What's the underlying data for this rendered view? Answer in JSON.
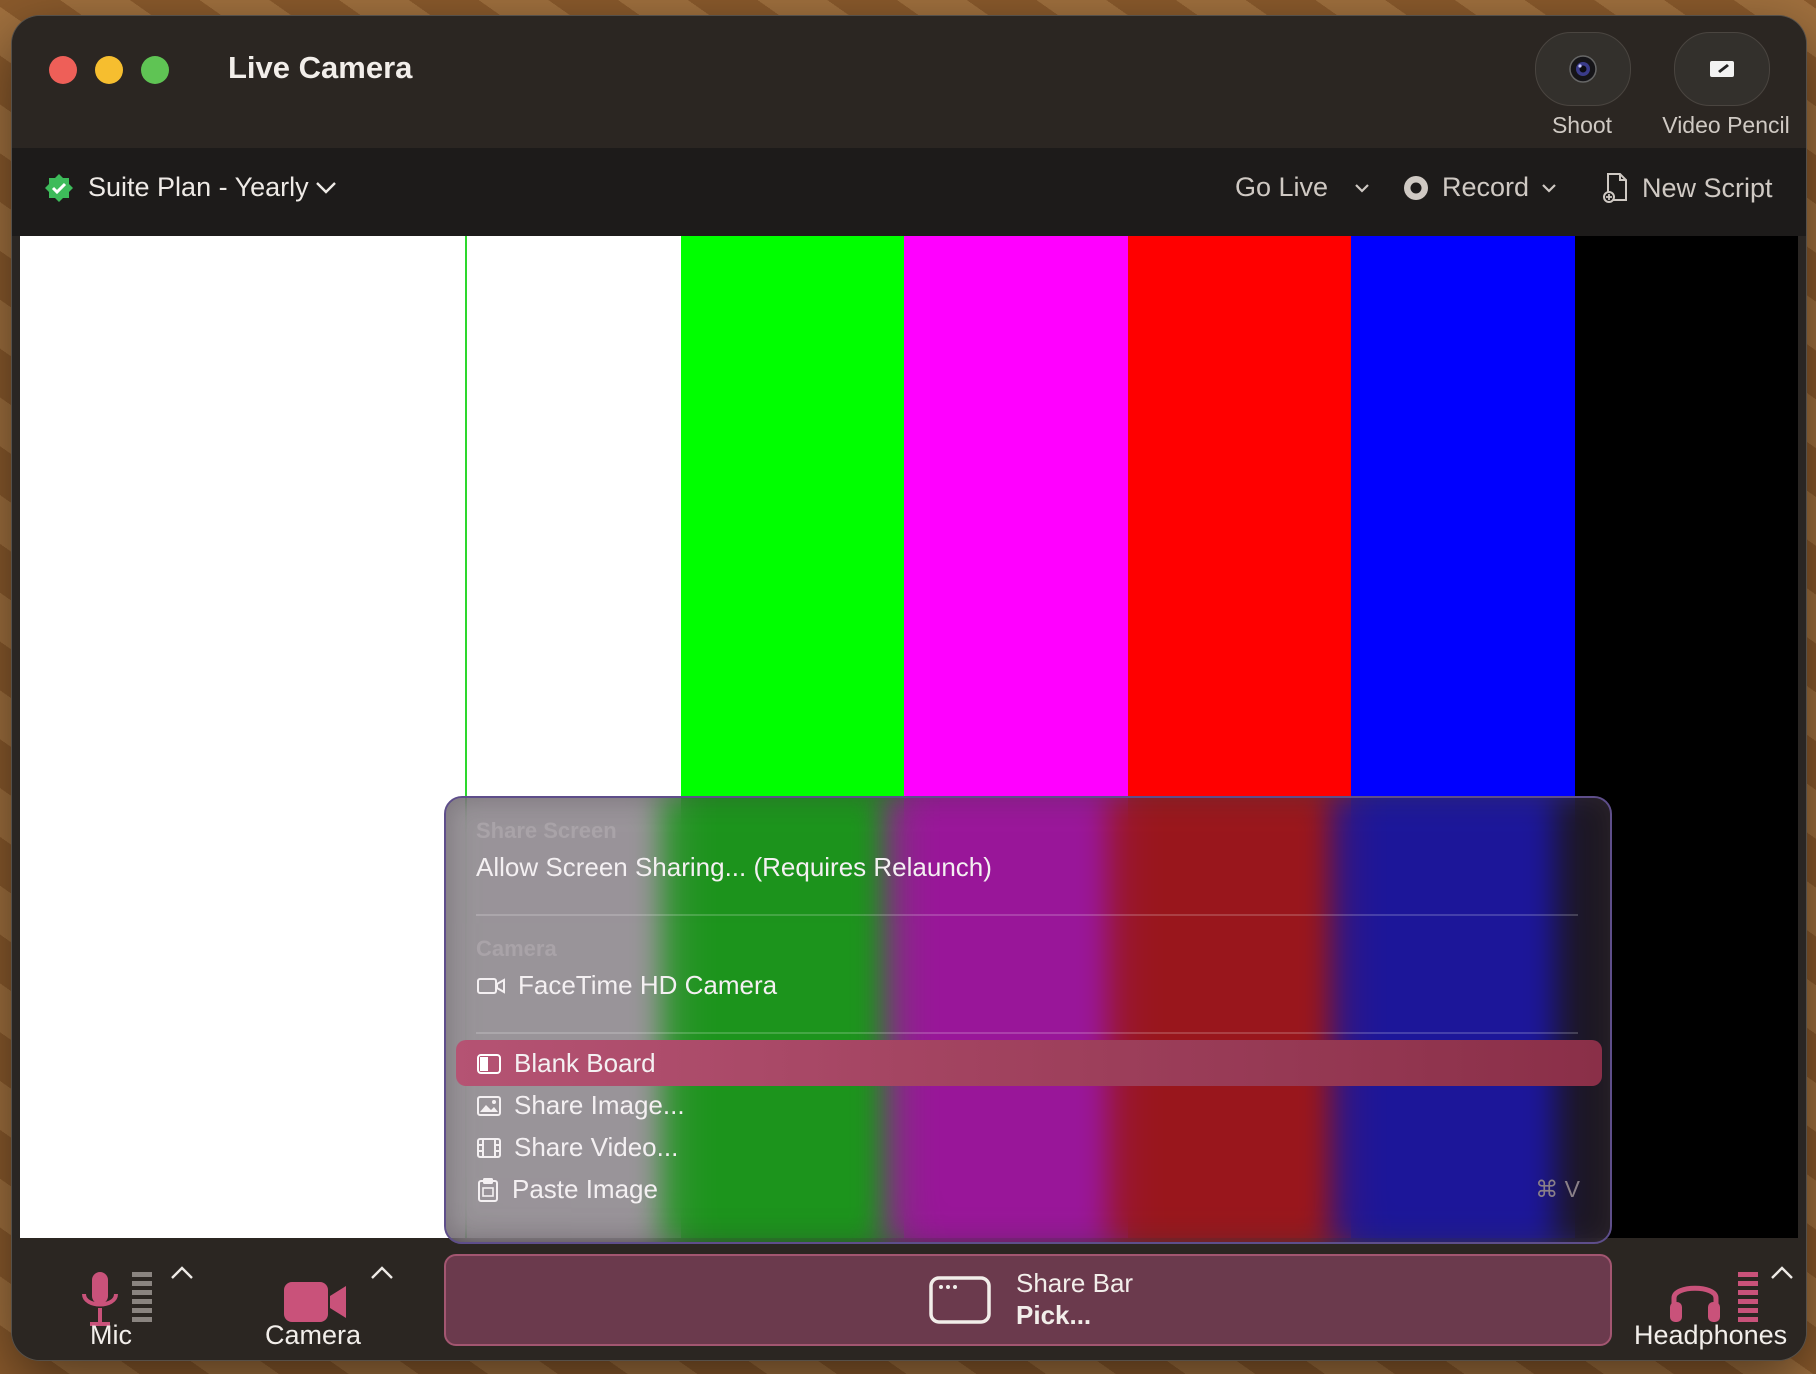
{
  "window": {
    "title": "Live Camera"
  },
  "top_buttons": [
    {
      "label": "Shoot",
      "icon": "camera-lens-icon"
    },
    {
      "label": "Video Pencil",
      "icon": "pencil-screen-icon"
    }
  ],
  "toolbar": {
    "plan_label": "Suite Plan - Yearly",
    "go_live_label": "Go Live",
    "record_label": "Record",
    "new_script_label": "New Script"
  },
  "preview": {
    "bars": [
      "#ffffff",
      "#ffffff",
      "#00ff00",
      "#ff00ff",
      "#ff0000",
      "#0000ff",
      "#000000"
    ]
  },
  "menu": {
    "section_share_screen": "Share Screen",
    "allow_sharing": "Allow Screen Sharing... (Requires Relaunch)",
    "section_camera": "Camera",
    "facetime": "FaceTime HD Camera",
    "blank_board": "Blank Board",
    "share_image": "Share Image...",
    "share_video": "Share Video...",
    "paste_image": "Paste Image",
    "paste_shortcut": "⌘ V"
  },
  "bottom": {
    "mic_label": "Mic",
    "camera_label": "Camera",
    "share_bar_title": "Share Bar",
    "share_bar_action": "Pick...",
    "headphones_label": "Headphones"
  },
  "colors": {
    "accent": "#c9527a",
    "check": "#3dbb5a"
  }
}
